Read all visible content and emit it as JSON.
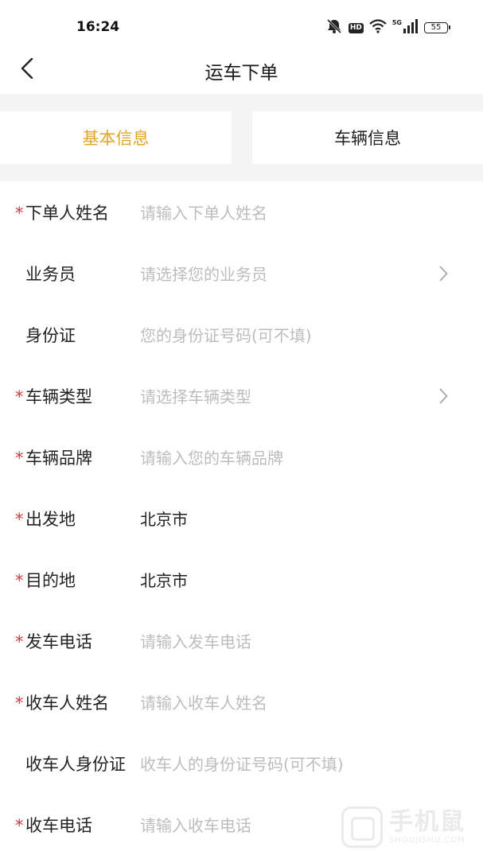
{
  "status_bar": {
    "time": "16:24",
    "network_label": "5G",
    "hd_label": "HD",
    "battery": "55",
    "icons": [
      "mute-bell-icon",
      "hd-icon",
      "wifi-icon",
      "signal-icon",
      "battery-icon"
    ]
  },
  "nav": {
    "title": "运车下单",
    "back_icon": "chevron-left-icon"
  },
  "tabs": [
    {
      "label": "基本信息",
      "active": true
    },
    {
      "label": "车辆信息",
      "active": false
    }
  ],
  "colors": {
    "accent": "#e3a628",
    "required": "#d0383c",
    "placeholder": "#bdbdbd",
    "section_bg": "#f4f4f4"
  },
  "form": {
    "fields": [
      {
        "label": "下单人姓名",
        "required": true,
        "placeholder": "请输入下单人姓名"
      },
      {
        "label": "业务员",
        "required": false,
        "placeholder": "请选择您的业务员",
        "chevron": true
      },
      {
        "label": "身份证",
        "required": false,
        "placeholder": "您的身份证号码(可不填)"
      },
      {
        "label": "车辆类型",
        "required": true,
        "placeholder": "请选择车辆类型",
        "chevron": true
      },
      {
        "label": "车辆品牌",
        "required": true,
        "placeholder": "请输入您的车辆品牌"
      },
      {
        "label": "出发地",
        "required": true,
        "value": "北京市"
      },
      {
        "label": "目的地",
        "required": true,
        "value": "北京市"
      },
      {
        "label": "发车电话",
        "required": true,
        "placeholder": "请输入发车电话"
      },
      {
        "label": "收车人姓名",
        "required": true,
        "placeholder": "请输入收车人姓名"
      },
      {
        "label": "收车人身份证",
        "required": false,
        "placeholder": "收车人的身份证号码(可不填)"
      },
      {
        "label": "收车电话",
        "required": true,
        "placeholder": "请输入收车电话"
      }
    ]
  },
  "watermark": {
    "cn": "手机鼠",
    "en": "SHOUJISHU.COM"
  }
}
